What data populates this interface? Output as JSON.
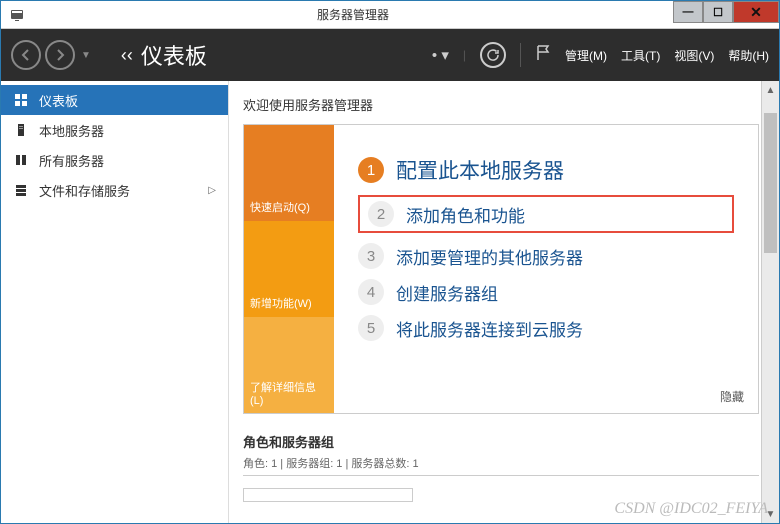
{
  "window": {
    "title": "服务器管理器"
  },
  "toolbar": {
    "breadcrumb_title": "仪表板",
    "menus": {
      "manage": "管理(M)",
      "tools": "工具(T)",
      "view": "视图(V)",
      "help": "帮助(H)"
    }
  },
  "sidebar": {
    "items": [
      {
        "label": "仪表板"
      },
      {
        "label": "本地服务器"
      },
      {
        "label": "所有服务器"
      },
      {
        "label": "文件和存储服务"
      }
    ]
  },
  "main": {
    "welcome_label": "欢迎使用服务器管理器",
    "left_tabs": {
      "quickstart": "快速启动(Q)",
      "whatsnew": "新增功能(W)",
      "learnmore": "了解详细信息(L)"
    },
    "steps": {
      "s1": "配置此本地服务器",
      "s2": "添加角色和功能",
      "s3": "添加要管理的其他服务器",
      "s4": "创建服务器组",
      "s5": "将此服务器连接到云服务"
    },
    "hide": "隐藏",
    "groups_title": "角色和服务器组",
    "groups_sub": "角色: 1 | 服务器组: 1 | 服务器总数: 1"
  },
  "watermark": "CSDN @IDC02_FEIYA"
}
